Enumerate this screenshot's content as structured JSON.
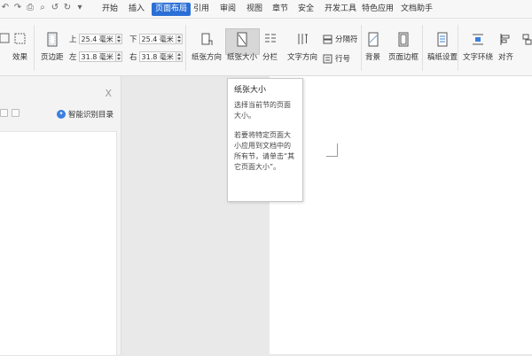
{
  "menubar": {
    "quick_icons": [
      "undo-icon",
      "redo-icon",
      "print-icon",
      "preview-icon",
      "undo-arrow-icon",
      "redo-arrow-icon",
      "dropdown-icon"
    ],
    "tabs": [
      {
        "label": "开始"
      },
      {
        "label": "插入"
      },
      {
        "label": "页面布局",
        "active": true
      },
      {
        "label": "引用"
      },
      {
        "label": "审阅"
      },
      {
        "label": "视图"
      },
      {
        "label": "章节"
      },
      {
        "label": "安全"
      },
      {
        "label": "开发工具"
      },
      {
        "label": "特色应用"
      },
      {
        "label": "文档助手"
      }
    ]
  },
  "ribbon": {
    "effects_label": "效果",
    "margins_label": "页边距",
    "margin_top_label": "上",
    "margin_top_value": "25.4 毫米",
    "margin_bottom_label": "下",
    "margin_bottom_value": "25.4 毫米",
    "margin_left_label": "左",
    "margin_left_value": "31.8 毫米",
    "margin_right_label": "右",
    "margin_right_value": "31.8 毫米",
    "orientation_label": "纸张方向",
    "size_label": "纸张大小",
    "columns_label": "分栏",
    "text_direction_label": "文字方向",
    "separator_label": "分隔符",
    "line_number_label": "行号",
    "background_label": "背景",
    "page_border_label": "页面边框",
    "manuscript_label": "稿纸设置",
    "text_wrap_label": "文字环绕",
    "align_label": "对齐"
  },
  "pane": {
    "close_label": "X",
    "smart_toc_label": "智能识别目录"
  },
  "tooltip": {
    "title": "纸张大小",
    "desc": "选择当前节的页面大小。",
    "hint": "若要将特定页面大小应用到文档中的所有节，请单击“其它页面大小”。"
  },
  "colors": {
    "accent": "#2b6fd6",
    "ribbon_bg": "#f7f7f7",
    "workspace": "#e9e9e9"
  }
}
